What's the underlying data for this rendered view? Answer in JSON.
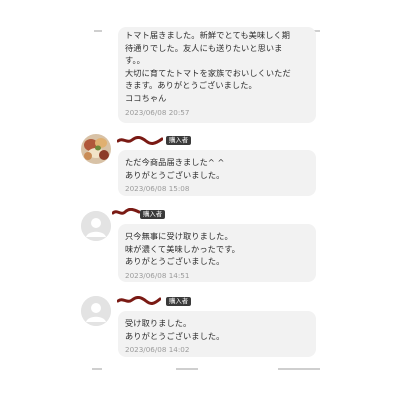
{
  "reviews": [
    {
      "lines": [
        "トマト届きました。新鮮でとても美味しく期",
        "待通りでした。友人にも送りたいと思いま",
        "す。。",
        "大切に育てたトマトを家族でおいしくいただ",
        "きます。ありがとうございました。",
        "ココちゃん"
      ],
      "timestamp": "2023/06/08 20:57"
    },
    {
      "avatar": "food-photo-avatar",
      "badge": "購入者",
      "lines": [
        "ただ今商品届きました^ ^",
        "ありがとうございました。"
      ],
      "timestamp": "2023/06/08 15:08"
    },
    {
      "avatar": "default-user-avatar",
      "badge": "購入者",
      "lines": [
        "只今無事に受け取りました。",
        "味が濃くて美味しかったです。",
        "ありがとうございました。"
      ],
      "timestamp": "2023/06/08 14:51"
    },
    {
      "avatar": "default-user-avatar",
      "badge": "購入者",
      "lines": [
        "受け取りました。",
        "ありがとうございました。"
      ],
      "timestamp": "2023/06/08 14:02"
    }
  ],
  "colors": {
    "bubble": "#f2f2f2",
    "badge": "#3a3a3a",
    "timestamp": "#9b9b9b",
    "redaction": "#7a1a14"
  }
}
